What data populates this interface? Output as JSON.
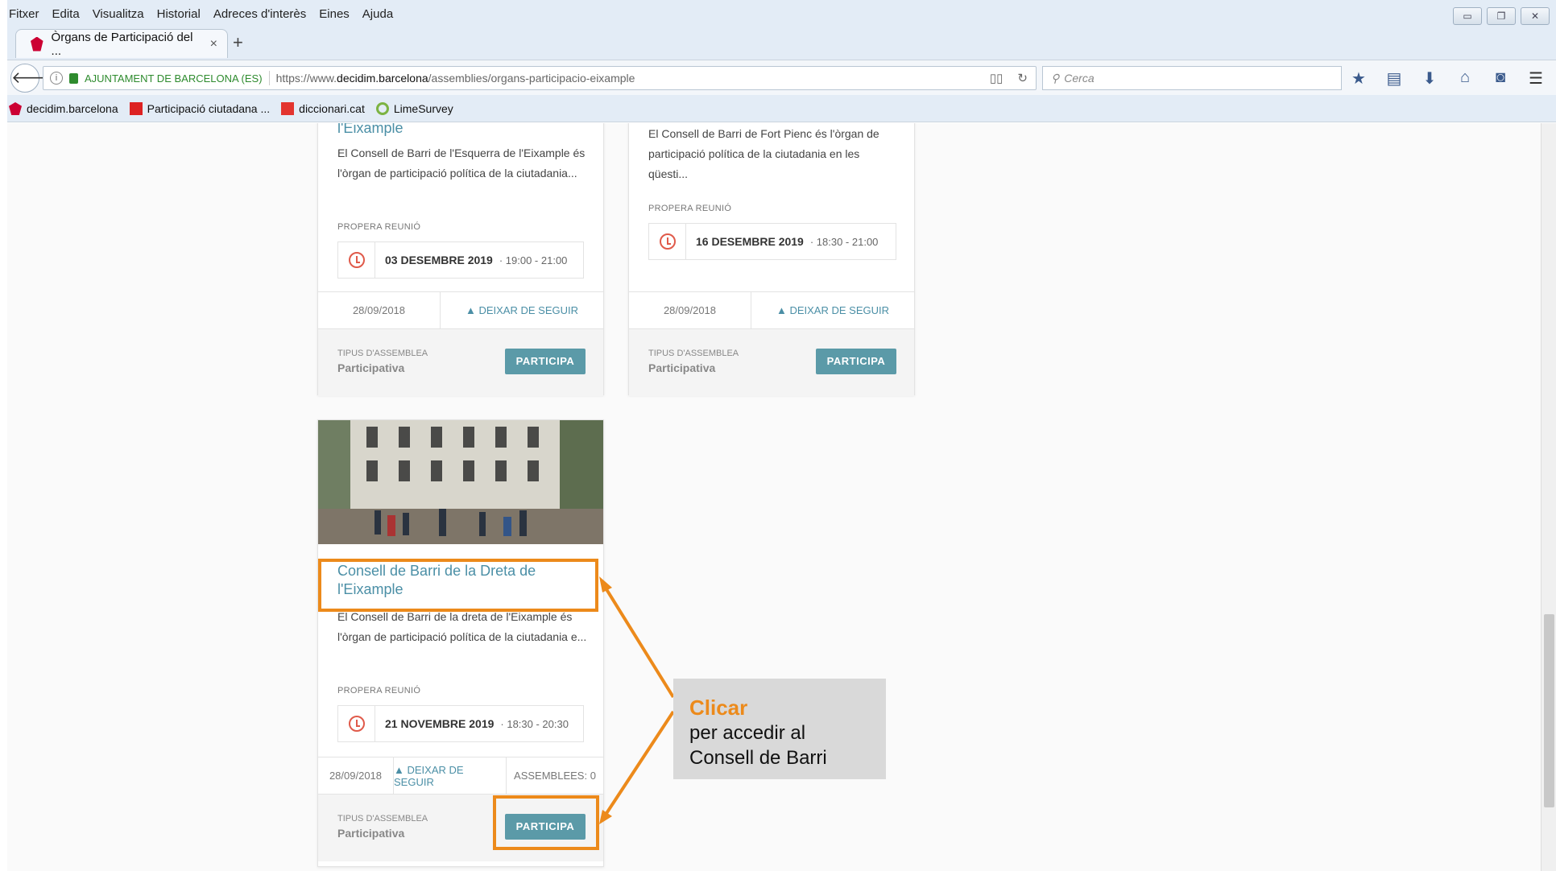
{
  "menu": [
    "Fitxer",
    "Edita",
    "Visualitza",
    "Historial",
    "Adreces d'interès",
    "Eines",
    "Ajuda"
  ],
  "tab": {
    "title": "Òrgans de Participació del ...",
    "close": "×",
    "new": "+"
  },
  "address": {
    "org": "AJUNTAMENT DE BARCELONA (ES)",
    "url_prefix": "https://www.",
    "url_domain": "decidim.barcelona",
    "url_path": "/assemblies/organs-participacio-eixample"
  },
  "search": {
    "placeholder": "Cerca"
  },
  "bookmarks": [
    "decidim.barcelona",
    "Participació ciutadana ...",
    "diccionari.cat",
    "LimeSurvey"
  ],
  "cards": [
    {
      "title": "l'Eixample",
      "desc": "El Consell de Barri de l'Esquerra de l'Eixample és l'òrgan de participació política de la ciutadania...",
      "next_label": "PROPERA REUNIÓ",
      "date": "03 DESEMBRE 2019",
      "time": "· 19:00 - 21:00",
      "created": "28/09/2018",
      "follow": "▲ DEIXAR DE SEGUIR",
      "type_label": "TIPUS D'ASSEMBLEA",
      "type_value": "Participativa",
      "button": "PARTICIPA"
    },
    {
      "desc": "El Consell de Barri de Fort Pienc és l'òrgan de participació política de la ciutadania en les qüesti...",
      "next_label": "PROPERA REUNIÓ",
      "date": "16 DESEMBRE 2019",
      "time": "· 18:30 - 21:00",
      "created": "28/09/2018",
      "follow": "▲ DEIXAR DE SEGUIR",
      "type_label": "TIPUS D'ASSEMBLEA",
      "type_value": "Participativa",
      "button": "PARTICIPA"
    },
    {
      "title": "Consell de Barri de la Dreta de l'Eixample",
      "desc": "El Consell de Barri de la dreta de l'Eixample és l'òrgan de participació política de la ciutadania e...",
      "next_label": "PROPERA REUNIÓ",
      "date": "21 NOVEMBRE 2019",
      "time": "· 18:30 - 20:30",
      "created": "28/09/2018",
      "follow": "▲ DEIXAR DE SEGUIR",
      "assemblies": "ASSEMBLEES: 0",
      "type_label": "TIPUS D'ASSEMBLEA",
      "type_value": "Participativa",
      "button": "PARTICIPA"
    }
  ],
  "annotation": {
    "headline": "Clicar",
    "line1": "per accedir al",
    "line2": "Consell de Barri"
  },
  "colors": {
    "accent": "#4b8fa6",
    "button": "#5b9aa8",
    "highlight": "#ec8a1b",
    "clock": "#e05a4a"
  }
}
